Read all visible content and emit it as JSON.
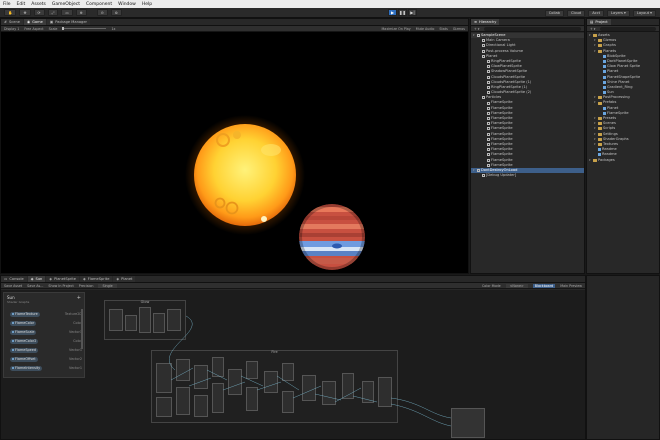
{
  "menu": [
    "File",
    "Edit",
    "Assets",
    "GameObject",
    "Component",
    "Window",
    "Help"
  ],
  "toolbar": {
    "account": "Acct",
    "collab": "Collab",
    "cloud": "Cloud",
    "play": "▶",
    "pause": "❚❚",
    "step": "▶|"
  },
  "scene_tabs": [
    "Scene",
    "Game",
    "Package Manager"
  ],
  "game_bar": {
    "display": "Display 1",
    "aspect": "Free Aspect",
    "scale_label": "Scale",
    "scale_value": "1x",
    "maximize": "Maximize On Play",
    "mute": "Mute Audio",
    "stats": "Stats",
    "gizmos": "Gizmos"
  },
  "hierarchy": {
    "tab": "Hierarchy",
    "rows": [
      {
        "label": "SampleScene",
        "depth": 0,
        "kind": "hdr"
      },
      {
        "label": "Main Camera",
        "depth": 1,
        "kind": "obj"
      },
      {
        "label": "Directional Light",
        "depth": 1,
        "kind": "obj"
      },
      {
        "label": "Post-process Volume",
        "depth": 1,
        "kind": "obj"
      },
      {
        "label": "Planet",
        "depth": 1,
        "kind": "obj"
      },
      {
        "label": "RingPlanetSprite",
        "depth": 2,
        "kind": "obj"
      },
      {
        "label": "GlowPlanetSprite",
        "depth": 2,
        "kind": "obj"
      },
      {
        "label": "ShadowPlanetSprite",
        "depth": 2,
        "kind": "obj"
      },
      {
        "label": "CloudsPlanetSprite",
        "depth": 2,
        "kind": "obj"
      },
      {
        "label": "CloudsPlanetSprite (1)",
        "depth": 2,
        "kind": "obj"
      },
      {
        "label": "RingPlanetSprite (1)",
        "depth": 2,
        "kind": "obj"
      },
      {
        "label": "CloudsPlanetSprite (2)",
        "depth": 2,
        "kind": "obj"
      },
      {
        "label": "Particles",
        "depth": 1,
        "kind": "obj"
      },
      {
        "label": "FlameSprite",
        "depth": 2,
        "kind": "obj"
      },
      {
        "label": "FlameSprite",
        "depth": 2,
        "kind": "obj"
      },
      {
        "label": "FlameSprite",
        "depth": 2,
        "kind": "obj"
      },
      {
        "label": "FlameSprite",
        "depth": 2,
        "kind": "obj"
      },
      {
        "label": "FlameSprite",
        "depth": 2,
        "kind": "obj"
      },
      {
        "label": "FlameSprite",
        "depth": 2,
        "kind": "obj"
      },
      {
        "label": "FlameSprite",
        "depth": 2,
        "kind": "obj"
      },
      {
        "label": "FlameSprite",
        "depth": 2,
        "kind": "obj"
      },
      {
        "label": "FlameSprite",
        "depth": 2,
        "kind": "obj"
      },
      {
        "label": "FlameSprite",
        "depth": 2,
        "kind": "obj"
      },
      {
        "label": "FlameSprite",
        "depth": 2,
        "kind": "obj"
      },
      {
        "label": "FlameSprite",
        "depth": 2,
        "kind": "obj"
      },
      {
        "label": "FlameSprite",
        "depth": 2,
        "kind": "obj"
      },
      {
        "label": "DontDestroyOnLoad",
        "depth": 0,
        "kind": "sel"
      },
      {
        "label": "[Debug Updater]",
        "depth": 1,
        "kind": "obj"
      }
    ]
  },
  "project": {
    "tab": "Project",
    "rows": [
      {
        "label": "Assets",
        "depth": 0,
        "kind": "folder"
      },
      {
        "label": "Gizmos",
        "depth": 1,
        "kind": "folder"
      },
      {
        "label": "Graphs",
        "depth": 1,
        "kind": "folder"
      },
      {
        "label": "Planets",
        "depth": 1,
        "kind": "folder"
      },
      {
        "label": "BlobSprite",
        "depth": 2,
        "kind": "asset"
      },
      {
        "label": "DarkPlanetSprite",
        "depth": 2,
        "kind": "asset"
      },
      {
        "label": "Glow Planet Sprite",
        "depth": 2,
        "kind": "asset"
      },
      {
        "label": "Planet",
        "depth": 2,
        "kind": "asset"
      },
      {
        "label": "PlanetShapeSprite",
        "depth": 2,
        "kind": "asset"
      },
      {
        "label": "Shine Planet",
        "depth": 2,
        "kind": "asset"
      },
      {
        "label": "Gradient_Ring",
        "depth": 2,
        "kind": "asset"
      },
      {
        "label": "Sun",
        "depth": 2,
        "kind": "asset"
      },
      {
        "label": "PostProcessing",
        "depth": 1,
        "kind": "folder"
      },
      {
        "label": "Prefabs",
        "depth": 1,
        "kind": "folder"
      },
      {
        "label": "Planet",
        "depth": 2,
        "kind": "asset"
      },
      {
        "label": "FlameSprite",
        "depth": 2,
        "kind": "asset"
      },
      {
        "label": "Presets",
        "depth": 1,
        "kind": "folder"
      },
      {
        "label": "Scenes",
        "depth": 1,
        "kind": "folder"
      },
      {
        "label": "Scripts",
        "depth": 1,
        "kind": "folder"
      },
      {
        "label": "Settings",
        "depth": 1,
        "kind": "folder"
      },
      {
        "label": "ShaderGraphs",
        "depth": 1,
        "kind": "folder"
      },
      {
        "label": "Textures",
        "depth": 1,
        "kind": "folder"
      },
      {
        "label": "Readme",
        "depth": 1,
        "kind": "asset"
      },
      {
        "label": "Readme",
        "depth": 1,
        "kind": "asset"
      },
      {
        "label": "Packages",
        "depth": 0,
        "kind": "folder"
      }
    ]
  },
  "bottom_tabs": [
    "Console",
    "Sun",
    "PlanetSprite",
    "FlameSprite",
    "Planet"
  ],
  "graph_bar": {
    "save": "Save Asset",
    "saveas": "Save As...",
    "show": "Show In Project",
    "precision": "Precision",
    "precision_value": "Single",
    "color_mode": "Color Mode",
    "color_mode_value": "<None>",
    "blackboard": "Blackboard",
    "preview": "Main Preview"
  },
  "blackboard": {
    "title": "Sun",
    "subtitle": "Shader Graphs",
    "add": "+",
    "items": [
      {
        "name": "FlameTexture",
        "type": "Texture2D"
      },
      {
        "name": "FlameColor",
        "type": "Color"
      },
      {
        "name": "FlameScale",
        "type": "Vector1"
      },
      {
        "name": "FlameColor2",
        "type": "Color"
      },
      {
        "name": "FlameSpeed",
        "type": "Vector1"
      },
      {
        "name": "FlameOffset",
        "type": "Vector2"
      },
      {
        "name": "FlameIntensity",
        "type": "Vector1"
      }
    ]
  },
  "graph_groups": [
    {
      "title": "Glow"
    },
    {
      "title": "Fire"
    }
  ],
  "colors": {
    "accent": "#3d5f8a",
    "play": "#2f6fbf",
    "sun_core": "#ffe04a",
    "sun_edge": "#ff8a10",
    "planet_red": "#d95a4a",
    "planet_blue": "#5a8ad0"
  }
}
